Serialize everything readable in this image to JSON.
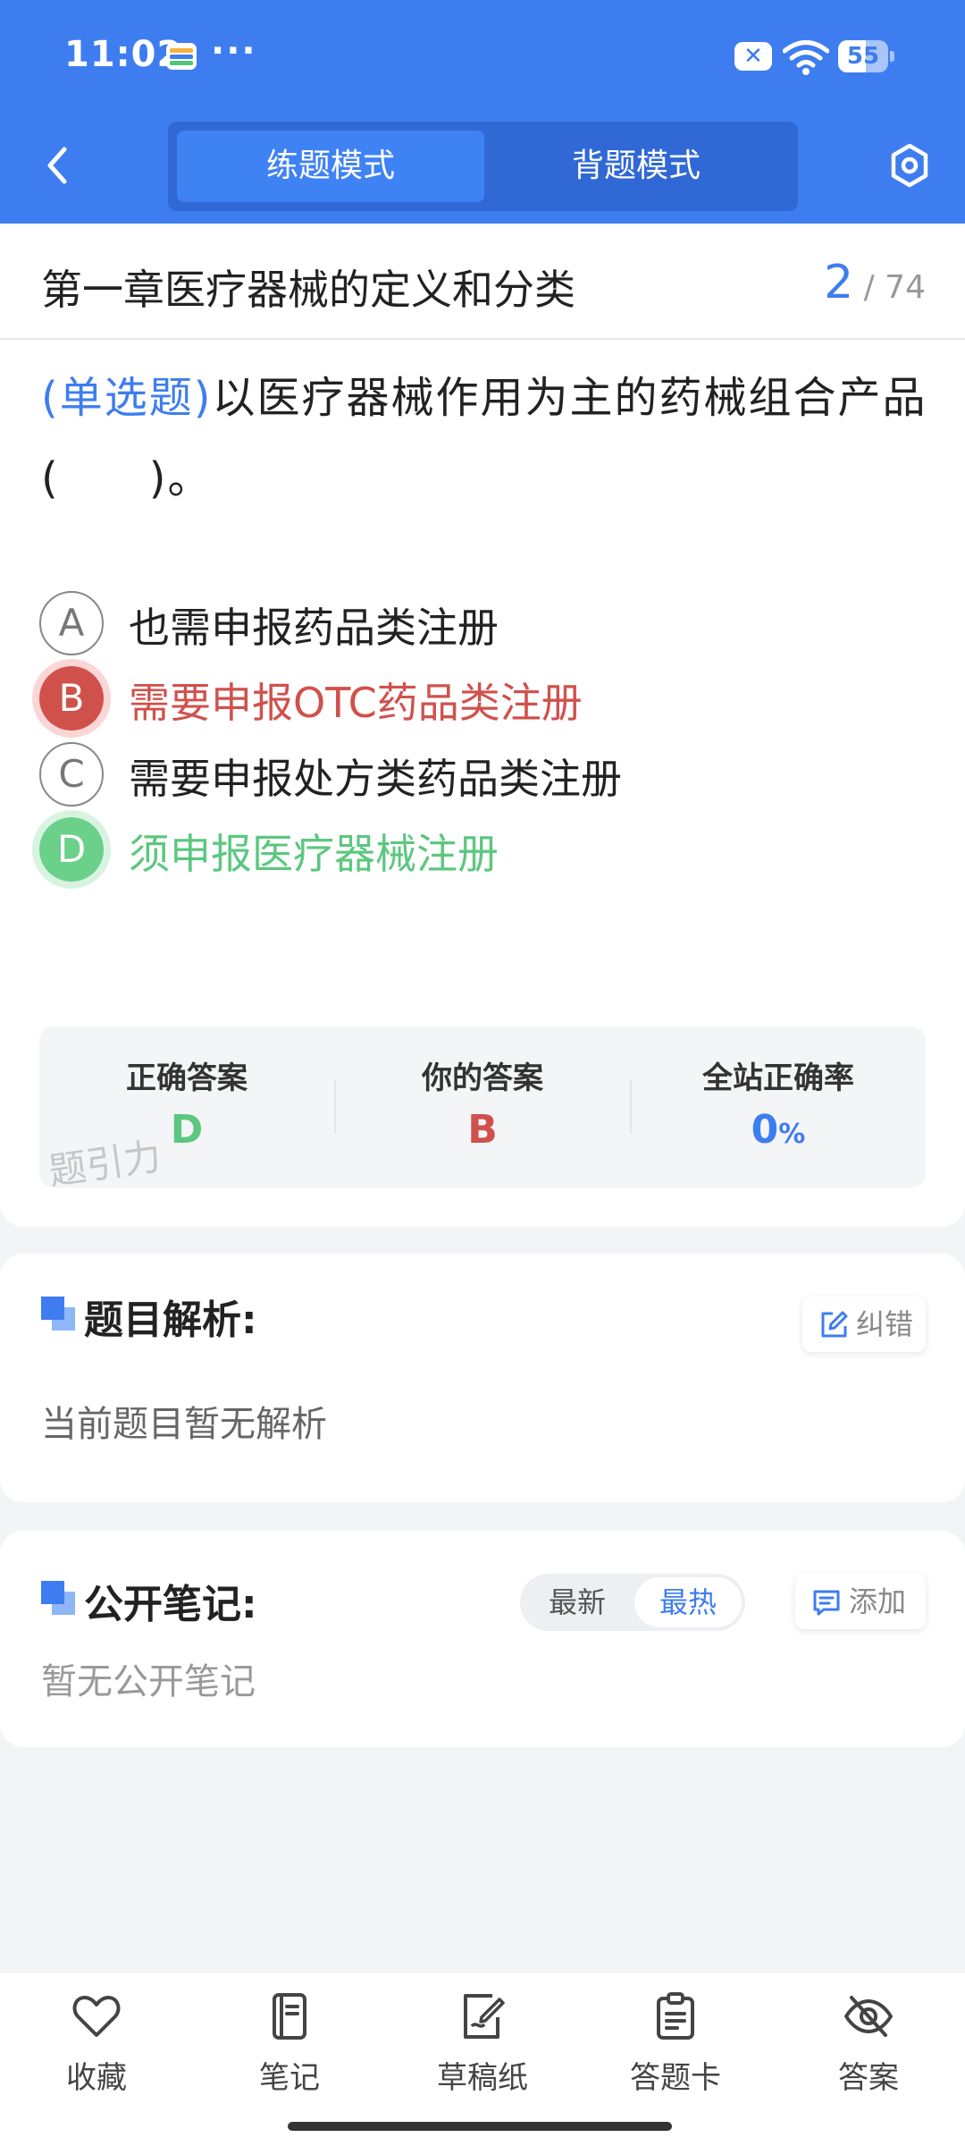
{
  "status_bar": {
    "time": "11:02",
    "dots": "···",
    "battery": "55"
  },
  "header": {
    "modes": [
      "练题模式",
      "背题模式"
    ],
    "active_mode": "练题模式"
  },
  "chapter": {
    "title": "第一章医疗器械的定义和分类",
    "current": "2",
    "total": "/ 74"
  },
  "question": {
    "type": "(单选题)",
    "text": "以医疗器械作用为主的药械组合产品(　　)。"
  },
  "options": [
    {
      "letter": "A",
      "text": "也需申报药品类注册",
      "state": "normal"
    },
    {
      "letter": "B",
      "text": "需要申报OTC药品类注册",
      "state": "wrong"
    },
    {
      "letter": "C",
      "text": "需要申报处方类药品类注册",
      "state": "normal"
    },
    {
      "letter": "D",
      "text": "须申报医疗器械注册",
      "state": "correct"
    }
  ],
  "stats": {
    "correct_label": "正确答案",
    "correct_value": "D",
    "yours_label": "你的答案",
    "yours_value": "B",
    "rate_label": "全站正确率",
    "rate_value": "0",
    "rate_unit": "%",
    "watermark": "题引力"
  },
  "explain": {
    "title": "题目解析:",
    "body": "当前题目暂无解析",
    "report_label": "纠错"
  },
  "notes": {
    "title": "公开笔记:",
    "body": "暂无公开笔记",
    "sort": [
      "最新",
      "最热"
    ],
    "active_sort": "最热",
    "add_label": "添加"
  },
  "bottom_nav": [
    "收藏",
    "笔记",
    "草稿纸",
    "答题卡",
    "答案"
  ],
  "colors": {
    "primary": "#3e7df0",
    "wrong": "#d0514c",
    "correct": "#5cc77f"
  }
}
